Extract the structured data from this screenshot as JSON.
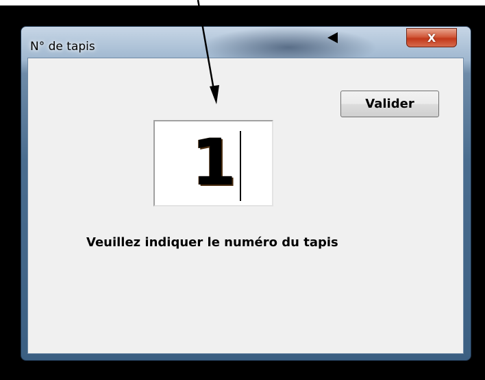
{
  "window": {
    "title": "N° de tapis",
    "close_glyph": "X"
  },
  "form": {
    "submit_label": "Valider",
    "number_value": "1",
    "instruction": "Veuillez indiquer le numéro du tapis"
  },
  "colors": {
    "dialog_background": "#f0f0f0",
    "close_button": "#c7432a",
    "frame": "#4a6d8f",
    "backdrop": "#000000"
  },
  "icons": {
    "annotation_arrow": "arrow-down-icon",
    "annotation_pointer": "triangle-left-icon"
  }
}
